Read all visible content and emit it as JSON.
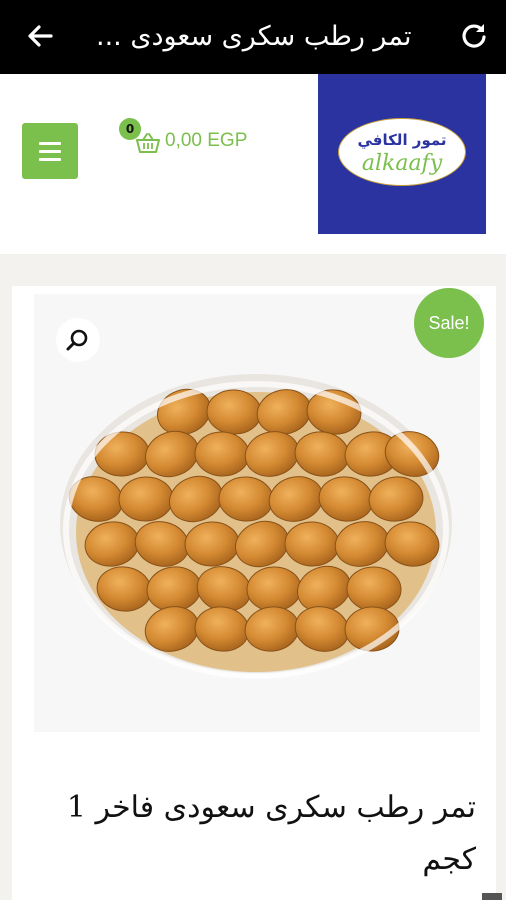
{
  "topbar": {
    "title": "تمر رطب سكرى سعودى ...",
    "back_icon": "arrow-left-icon",
    "refresh_icon": "refresh-icon"
  },
  "header": {
    "menu_icon": "hamburger-menu-icon",
    "cart": {
      "count": "0",
      "amount": "0,00 EGP",
      "icon": "basket-icon"
    },
    "logo": {
      "arabic_text": "تمور الكافي",
      "english_text": "alkaafy"
    }
  },
  "product": {
    "sale_badge": "Sale!",
    "title": "تمر رطب سكرى سعودى فاخر 1 كجم",
    "zoom_icon": "search-zoom-icon"
  },
  "colors": {
    "accent_green": "#7bbf4c",
    "logo_blue": "#2a33a0",
    "topbar_black": "#000000"
  }
}
